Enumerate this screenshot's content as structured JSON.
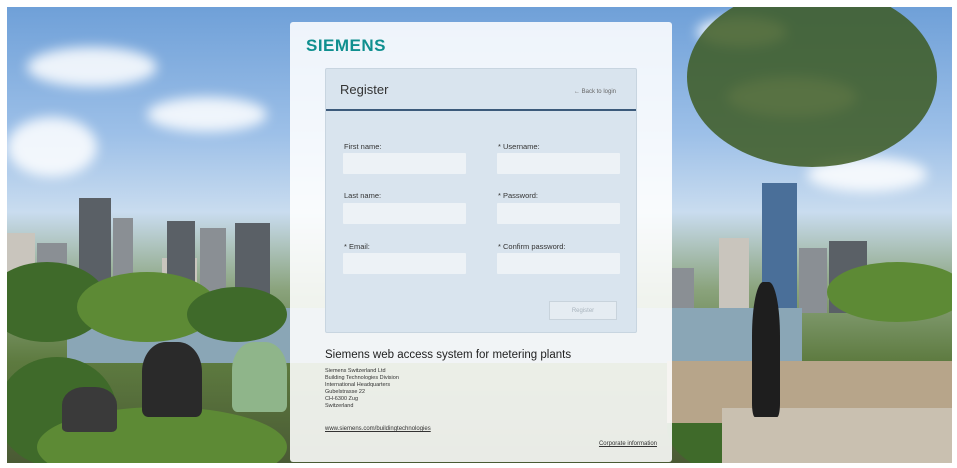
{
  "brand": {
    "logo_text": "SIEMENS",
    "color": "#0f8f8f"
  },
  "register_form": {
    "title": "Register",
    "back_link": "← Back to login",
    "fields": {
      "first_name": {
        "label": "First name:",
        "value": ""
      },
      "username": {
        "label": "* Username:",
        "value": ""
      },
      "last_name": {
        "label": "Last name:",
        "value": ""
      },
      "password": {
        "label": "* Password:",
        "value": ""
      },
      "email": {
        "label": "* Email:",
        "value": ""
      },
      "confirm_password": {
        "label": "* Confirm password:",
        "value": ""
      }
    },
    "submit_label": "Register",
    "accent_color": "#3c5a7a"
  },
  "footer": {
    "system_title": "Siemens web access system for metering plants",
    "address_lines": [
      "Siemens Switzerland Ltd",
      "Building Technologies Division",
      "International Headquarters",
      "Gubelstrasse 22",
      "CH-6300 Zug",
      "Switzerland"
    ],
    "website": "www.siemens.com/buildingtechnologies",
    "corporate_link": "Corporate information"
  }
}
